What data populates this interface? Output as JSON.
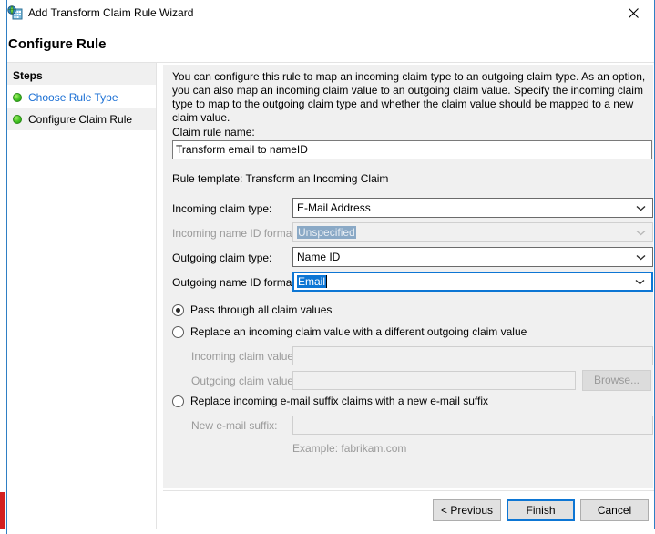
{
  "window": {
    "title": "Add Transform Claim Rule Wizard",
    "icon": "adfs-claim-rule-icon",
    "close_label": "✕"
  },
  "page": {
    "heading": "Configure Rule",
    "intro": "You can configure this rule to map an incoming claim type to an outgoing claim type. As an option, you can also map an incoming claim value to an outgoing claim value. Specify the incoming claim type to map to the outgoing claim type and whether the claim value should be mapped to a new claim value."
  },
  "sidebar": {
    "title": "Steps",
    "items": [
      {
        "label": "Choose Rule Type",
        "state": "link"
      },
      {
        "label": "Configure Claim Rule",
        "state": "current"
      }
    ]
  },
  "form": {
    "rule_name_label": "Claim rule name:",
    "rule_name_value": "Transform email to nameID",
    "rule_template_text": "Rule template: Transform an Incoming Claim",
    "incoming_claim_type_label": "Incoming claim type:",
    "incoming_claim_type_value": "E-Mail Address",
    "incoming_name_id_format_label": "Incoming name ID format:",
    "incoming_name_id_format_value": "Unspecified",
    "outgoing_claim_type_label": "Outgoing claim type:",
    "outgoing_claim_type_value": "Name ID",
    "outgoing_name_id_format_label": "Outgoing name ID format:",
    "outgoing_name_id_format_value": "Email"
  },
  "options": {
    "pass_through_label": "Pass through all claim values",
    "replace_value_label": "Replace an incoming claim value with a different outgoing claim value",
    "incoming_claim_value_label": "Incoming claim value:",
    "incoming_claim_value": "",
    "outgoing_claim_value_label": "Outgoing claim value:",
    "outgoing_claim_value": "",
    "browse_label": "Browse...",
    "replace_suffix_label": "Replace incoming e-mail suffix claims with a new e-mail suffix",
    "new_suffix_label": "New e-mail suffix:",
    "new_suffix_value": "",
    "example_text": "Example: fabrikam.com"
  },
  "footer": {
    "previous_label": "< Previous",
    "finish_label": "Finish",
    "cancel_label": "Cancel"
  },
  "colors": {
    "accent_blue": "#0d76d4",
    "link_blue": "#1a6fd4",
    "panel_gray": "#f0f0f0",
    "disabled_gray": "#9a9a9a"
  }
}
